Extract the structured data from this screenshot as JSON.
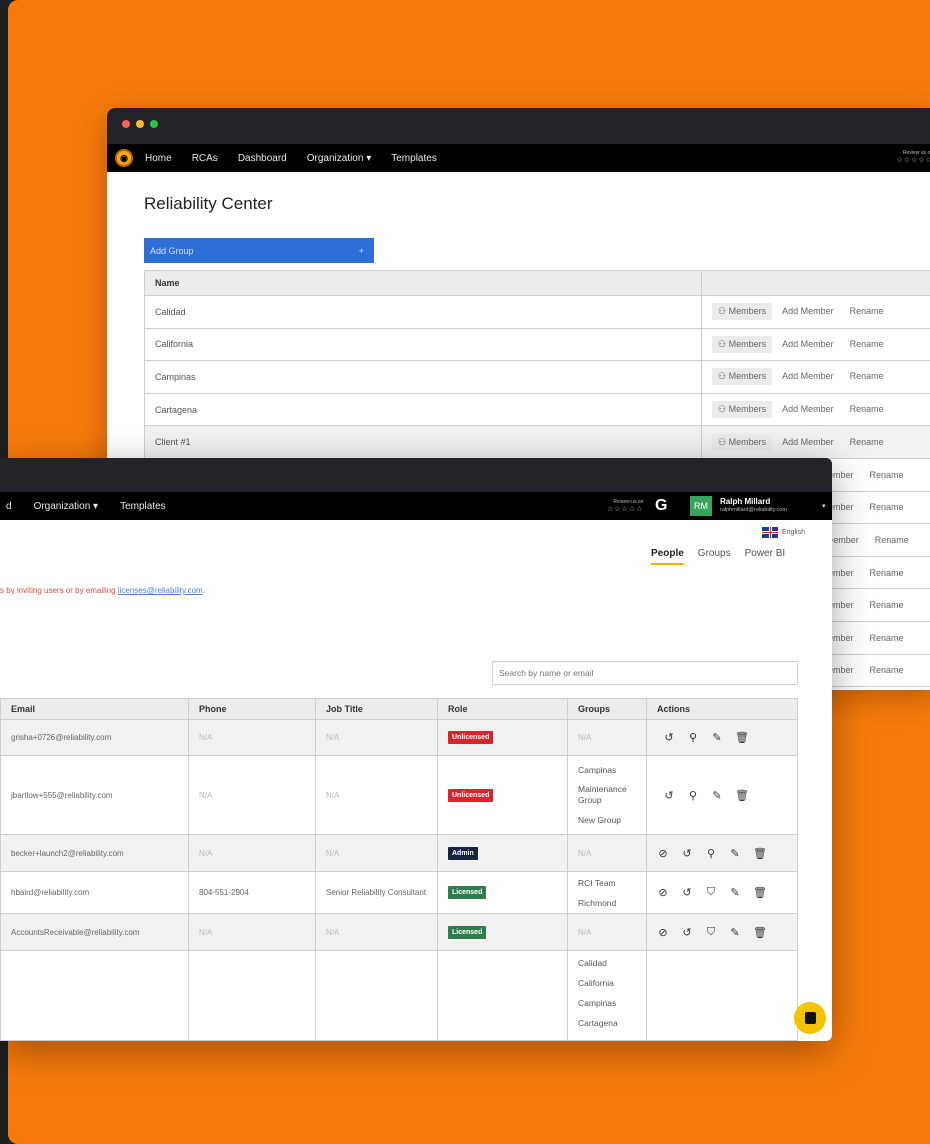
{
  "back_window": {
    "nav": [
      "Home",
      "RCAs",
      "Dashboard",
      "Organization",
      "Templates"
    ],
    "review": {
      "label": "Review us on",
      "stars": "☆☆☆☆☆"
    },
    "title": "Reliability Center",
    "add_group": {
      "label": "Add Group",
      "icon": "+"
    },
    "table_header": "Name",
    "members_label": "Members",
    "add_member_label": "Add Member",
    "rename_label": "Rename",
    "partial_member_label": "ember",
    "partial_member_label_6": ">ember",
    "groups": [
      "Calidad",
      "California",
      "Campinas",
      "Cartagena",
      "Client #1"
    ]
  },
  "front_window": {
    "nav": [
      "d",
      "Organization",
      "Templates"
    ],
    "review": {
      "label": "Review us on",
      "stars": "☆☆☆☆☆",
      "brand": "G"
    },
    "user": {
      "initials": "RM",
      "name": "Ralph Millard",
      "email": "ralphmillard@reliability.com"
    },
    "language": "English",
    "tabs": [
      "People",
      "Groups",
      "Power BI"
    ],
    "notice": {
      "text": "s by inviting users or by emailing ",
      "link": "licenses@reliability.com",
      "end": "."
    },
    "search_placeholder": "Search by name or email",
    "columns": [
      "Email",
      "Phone",
      "Job Title",
      "Role",
      "Groups",
      "Actions"
    ],
    "rows": [
      {
        "email": "grisha+0726@reliability.com",
        "phone": "N/A",
        "job": "N/A",
        "role": "Unlicensed",
        "groups": [
          "N/A"
        ]
      },
      {
        "email": "jbartlow+555@reliability.com",
        "phone": "N/A",
        "job": "N/A",
        "role": "Unlicensed",
        "groups": [
          "Campinas",
          "Maintenance Group",
          "New Group"
        ]
      },
      {
        "email": "becker+launch2@reliability.com",
        "phone": "N/A",
        "job": "N/A",
        "role": "Admin",
        "groups": [
          "N/A"
        ]
      },
      {
        "email": "hbaird@reliability.com",
        "phone": "804-551-2904",
        "job": "Senior Reliability Consultant",
        "role": "Licensed",
        "groups": [
          "RCI Team",
          "Richmond"
        ]
      },
      {
        "email": "AccountsReceivable@reliability.com",
        "phone": "N/A",
        "job": "N/A",
        "role": "Licensed",
        "groups": [
          "N/A"
        ]
      },
      {
        "email": "",
        "phone": "",
        "job": "",
        "role": "",
        "groups": [
          "Calidad",
          "California",
          "Campinas",
          "Cartagena"
        ]
      }
    ]
  },
  "colors": {
    "background": "#f77a0a",
    "unlicensed": "#d6262c",
    "admin": "#16253f",
    "licensed": "#2f7d4f",
    "primary": "#2d6fd6",
    "chat": "#f5c400"
  }
}
